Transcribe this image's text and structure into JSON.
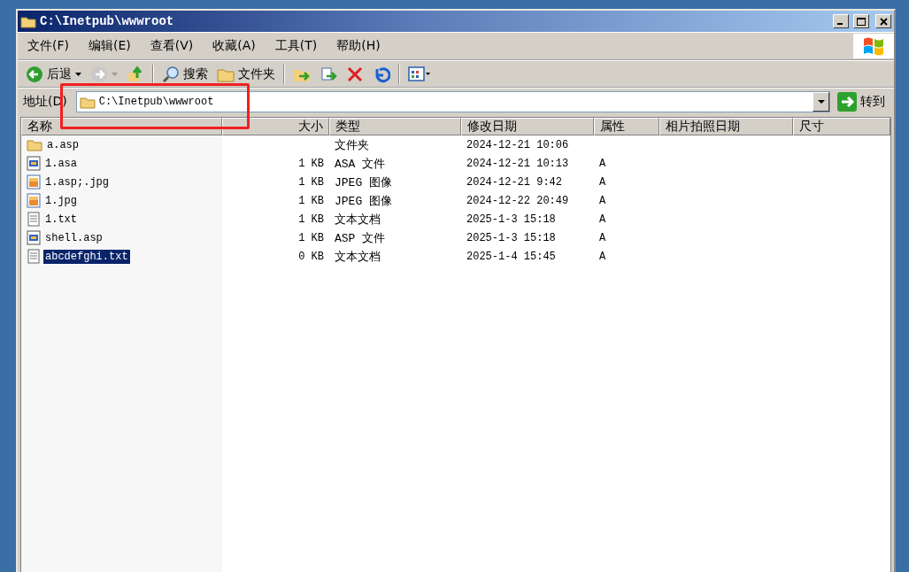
{
  "window": {
    "title": "C:\\Inetpub\\wwwroot"
  },
  "menu": [
    {
      "label": "文件(F)"
    },
    {
      "label": "编辑(E)"
    },
    {
      "label": "查看(V)"
    },
    {
      "label": "收藏(A)"
    },
    {
      "label": "工具(T)"
    },
    {
      "label": "帮助(H)"
    }
  ],
  "toolbar": [
    {
      "kind": "back",
      "label": "后退"
    },
    {
      "kind": "forward"
    },
    {
      "kind": "up"
    },
    {
      "kind": "search",
      "label": "搜索"
    },
    {
      "kind": "folders",
      "label": "文件夹"
    },
    {
      "kind": "move"
    },
    {
      "kind": "copy"
    },
    {
      "kind": "delete"
    },
    {
      "kind": "undo"
    },
    {
      "kind": "views"
    }
  ],
  "address": {
    "label": "地址(D)",
    "value": "C:\\Inetpub\\wwwroot",
    "go": "转到"
  },
  "table": {
    "columns": [
      {
        "label": "名称"
      },
      {
        "label": "大小"
      },
      {
        "label": "类型"
      },
      {
        "label": "修改日期"
      },
      {
        "label": "属性"
      },
      {
        "label": "相片拍照日期"
      },
      {
        "label": "尺寸"
      }
    ],
    "rows": [
      {
        "kind": "folder",
        "name": "a.asp",
        "size": "",
        "type": "文件夹",
        "modified": "2024-12-21 10:06",
        "attr": "",
        "selected": false
      },
      {
        "kind": "script",
        "name": "1.asa",
        "size": "1 KB",
        "type": "ASA 文件",
        "modified": "2024-12-21 10:13",
        "attr": "A",
        "selected": false
      },
      {
        "kind": "image",
        "name": "1.asp;.jpg",
        "size": "1 KB",
        "type": "JPEG 图像",
        "modified": "2024-12-21 9:42",
        "attr": "A",
        "selected": false
      },
      {
        "kind": "image",
        "name": "1.jpg",
        "size": "1 KB",
        "type": "JPEG 图像",
        "modified": "2024-12-22 20:49",
        "attr": "A",
        "selected": false
      },
      {
        "kind": "text",
        "name": "1.txt",
        "size": "1 KB",
        "type": "文本文档",
        "modified": "2025-1-3 15:18",
        "attr": "A",
        "selected": false
      },
      {
        "kind": "script",
        "name": "shell.asp",
        "size": "1 KB",
        "type": "ASP 文件",
        "modified": "2025-1-3 15:18",
        "attr": "A",
        "selected": false
      },
      {
        "kind": "text",
        "name": "abcdefghi.txt",
        "size": "0 KB",
        "type": "文本文档",
        "modified": "2025-1-4 15:45",
        "attr": "A",
        "selected": true
      }
    ]
  }
}
